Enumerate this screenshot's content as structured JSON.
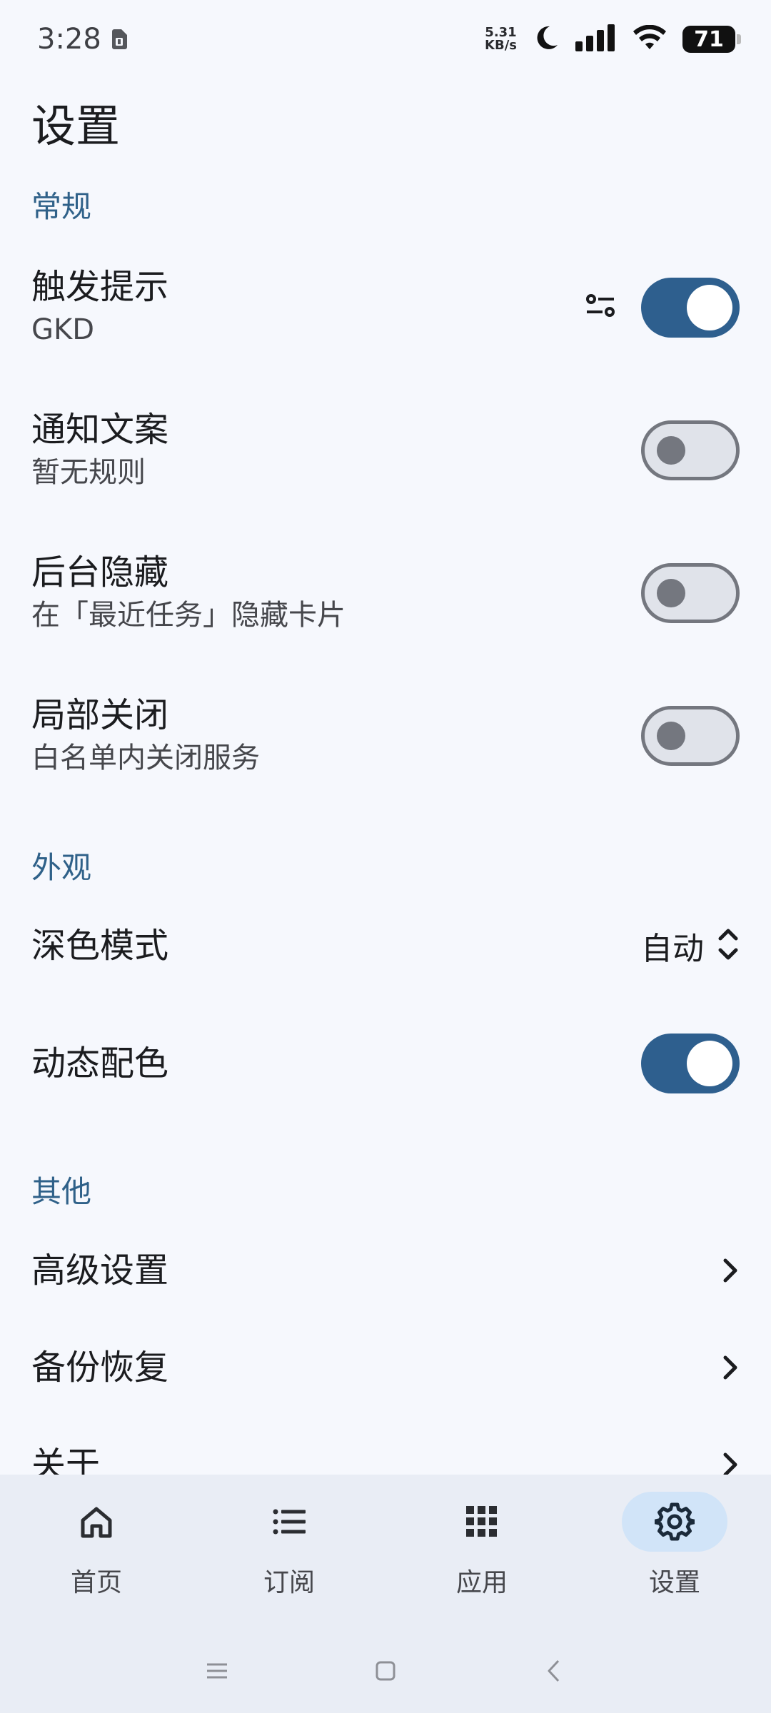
{
  "status_bar": {
    "time": "3:28",
    "net_speed_value": "5.31",
    "net_speed_unit": "KB/s",
    "battery": "71",
    "icons": [
      "sim-card-icon",
      "moon-icon",
      "signal-icon",
      "wifi-icon",
      "battery-icon"
    ]
  },
  "page": {
    "title": "设置"
  },
  "sections": {
    "general": "常规",
    "appearance": "外观",
    "other": "其他"
  },
  "general": {
    "trigger_tip": {
      "title": "触发提示",
      "subtitle": "GKD",
      "enabled": true
    },
    "notification_text": {
      "title": "通知文案",
      "subtitle": "暂无规则",
      "enabled": false
    },
    "hide_background": {
      "title": "后台隐藏",
      "subtitle": "在「最近任务」隐藏卡片",
      "enabled": false
    },
    "partial_close": {
      "title": "局部关闭",
      "subtitle": "白名单内关闭服务",
      "enabled": false
    }
  },
  "appearance": {
    "dark_mode": {
      "title": "深色模式",
      "value": "自动"
    },
    "dynamic_color": {
      "title": "动态配色",
      "enabled": true
    }
  },
  "other": {
    "advanced": "高级设置",
    "backup": "备份恢复",
    "about": "关于"
  },
  "bottom_nav": {
    "items": [
      {
        "label": "首页",
        "icon": "home-icon"
      },
      {
        "label": "订阅",
        "icon": "list-icon"
      },
      {
        "label": "应用",
        "icon": "apps-grid-icon"
      },
      {
        "label": "设置",
        "icon": "gear-icon",
        "active": true
      }
    ]
  },
  "colors": {
    "accent": "#2e5f8e",
    "section_title": "#2f6189",
    "background": "#f6f8fd",
    "nav_background": "#e9edf5",
    "nav_active_pill": "#d1e4f8"
  }
}
